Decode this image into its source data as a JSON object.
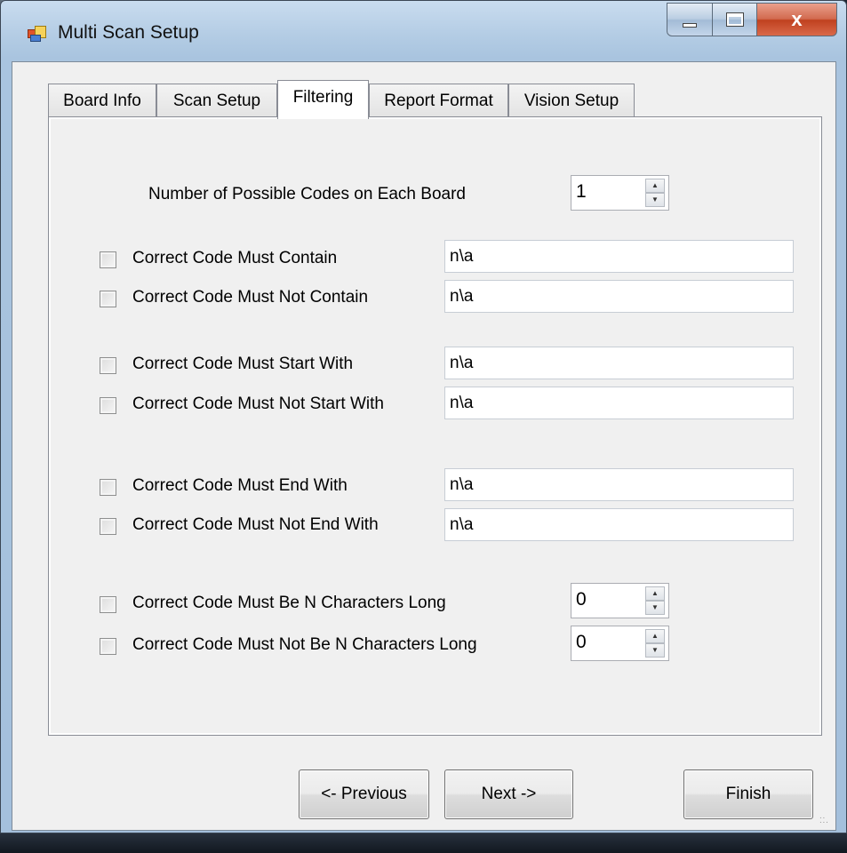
{
  "window": {
    "title": "Multi Scan Setup",
    "close_label": "x"
  },
  "tabs": [
    {
      "label": "Board Info"
    },
    {
      "label": "Scan Setup"
    },
    {
      "label": "Filtering"
    },
    {
      "label": "Report Format"
    },
    {
      "label": "Vision Setup"
    }
  ],
  "active_tab": "Filtering",
  "filtering": {
    "num_codes_label": "Number of Possible Codes on Each Board",
    "num_codes_value": "1",
    "rows": [
      {
        "label": "Correct Code Must Contain",
        "value": "n\\a",
        "checked": false
      },
      {
        "label": "Correct Code Must Not Contain",
        "value": "n\\a",
        "checked": false
      },
      {
        "label": "Correct Code Must Start With",
        "value": "n\\a",
        "checked": false
      },
      {
        "label": "Correct Code Must Not Start With",
        "value": "n\\a",
        "checked": false
      },
      {
        "label": "Correct Code Must End With",
        "value": "n\\a",
        "checked": false
      },
      {
        "label": "Correct Code Must Not End With",
        "value": "n\\a",
        "checked": false
      }
    ],
    "length_rows": [
      {
        "label": "Correct Code Must Be N Characters Long",
        "value": "0",
        "checked": false
      },
      {
        "label": "Correct Code Must Not Be N Characters Long",
        "value": "0",
        "checked": false
      }
    ]
  },
  "buttons": {
    "previous": "<- Previous",
    "next": "Next ->",
    "finish": "Finish"
  },
  "icons": {
    "app": "app-icon",
    "spin_up": "up-arrow-icon",
    "spin_down": "down-arrow-icon"
  }
}
